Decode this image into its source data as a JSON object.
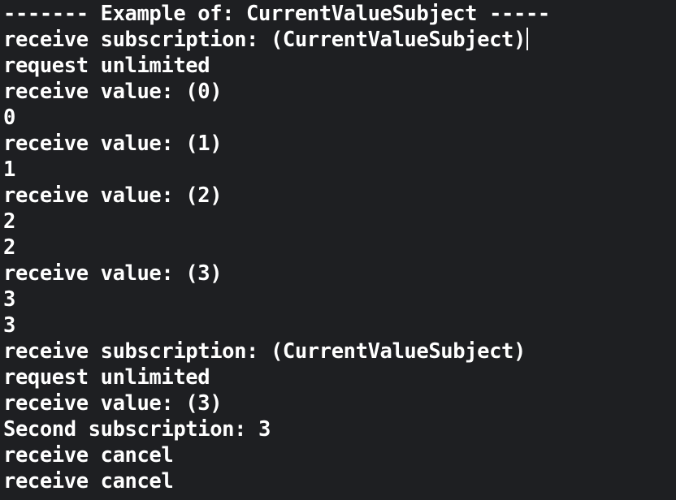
{
  "console": {
    "lines": [
      "------- Example of: CurrentValueSubject -----",
      "receive subscription: (CurrentValueSubject)",
      "request unlimited",
      "receive value: (0)",
      "0",
      "receive value: (1)",
      "1",
      "receive value: (2)",
      "2",
      "2",
      "receive value: (3)",
      "3",
      "3",
      "receive subscription: (CurrentValueSubject)",
      "request unlimited",
      "receive value: (3)",
      "Second subscription: 3",
      "receive cancel",
      "receive cancel"
    ]
  }
}
